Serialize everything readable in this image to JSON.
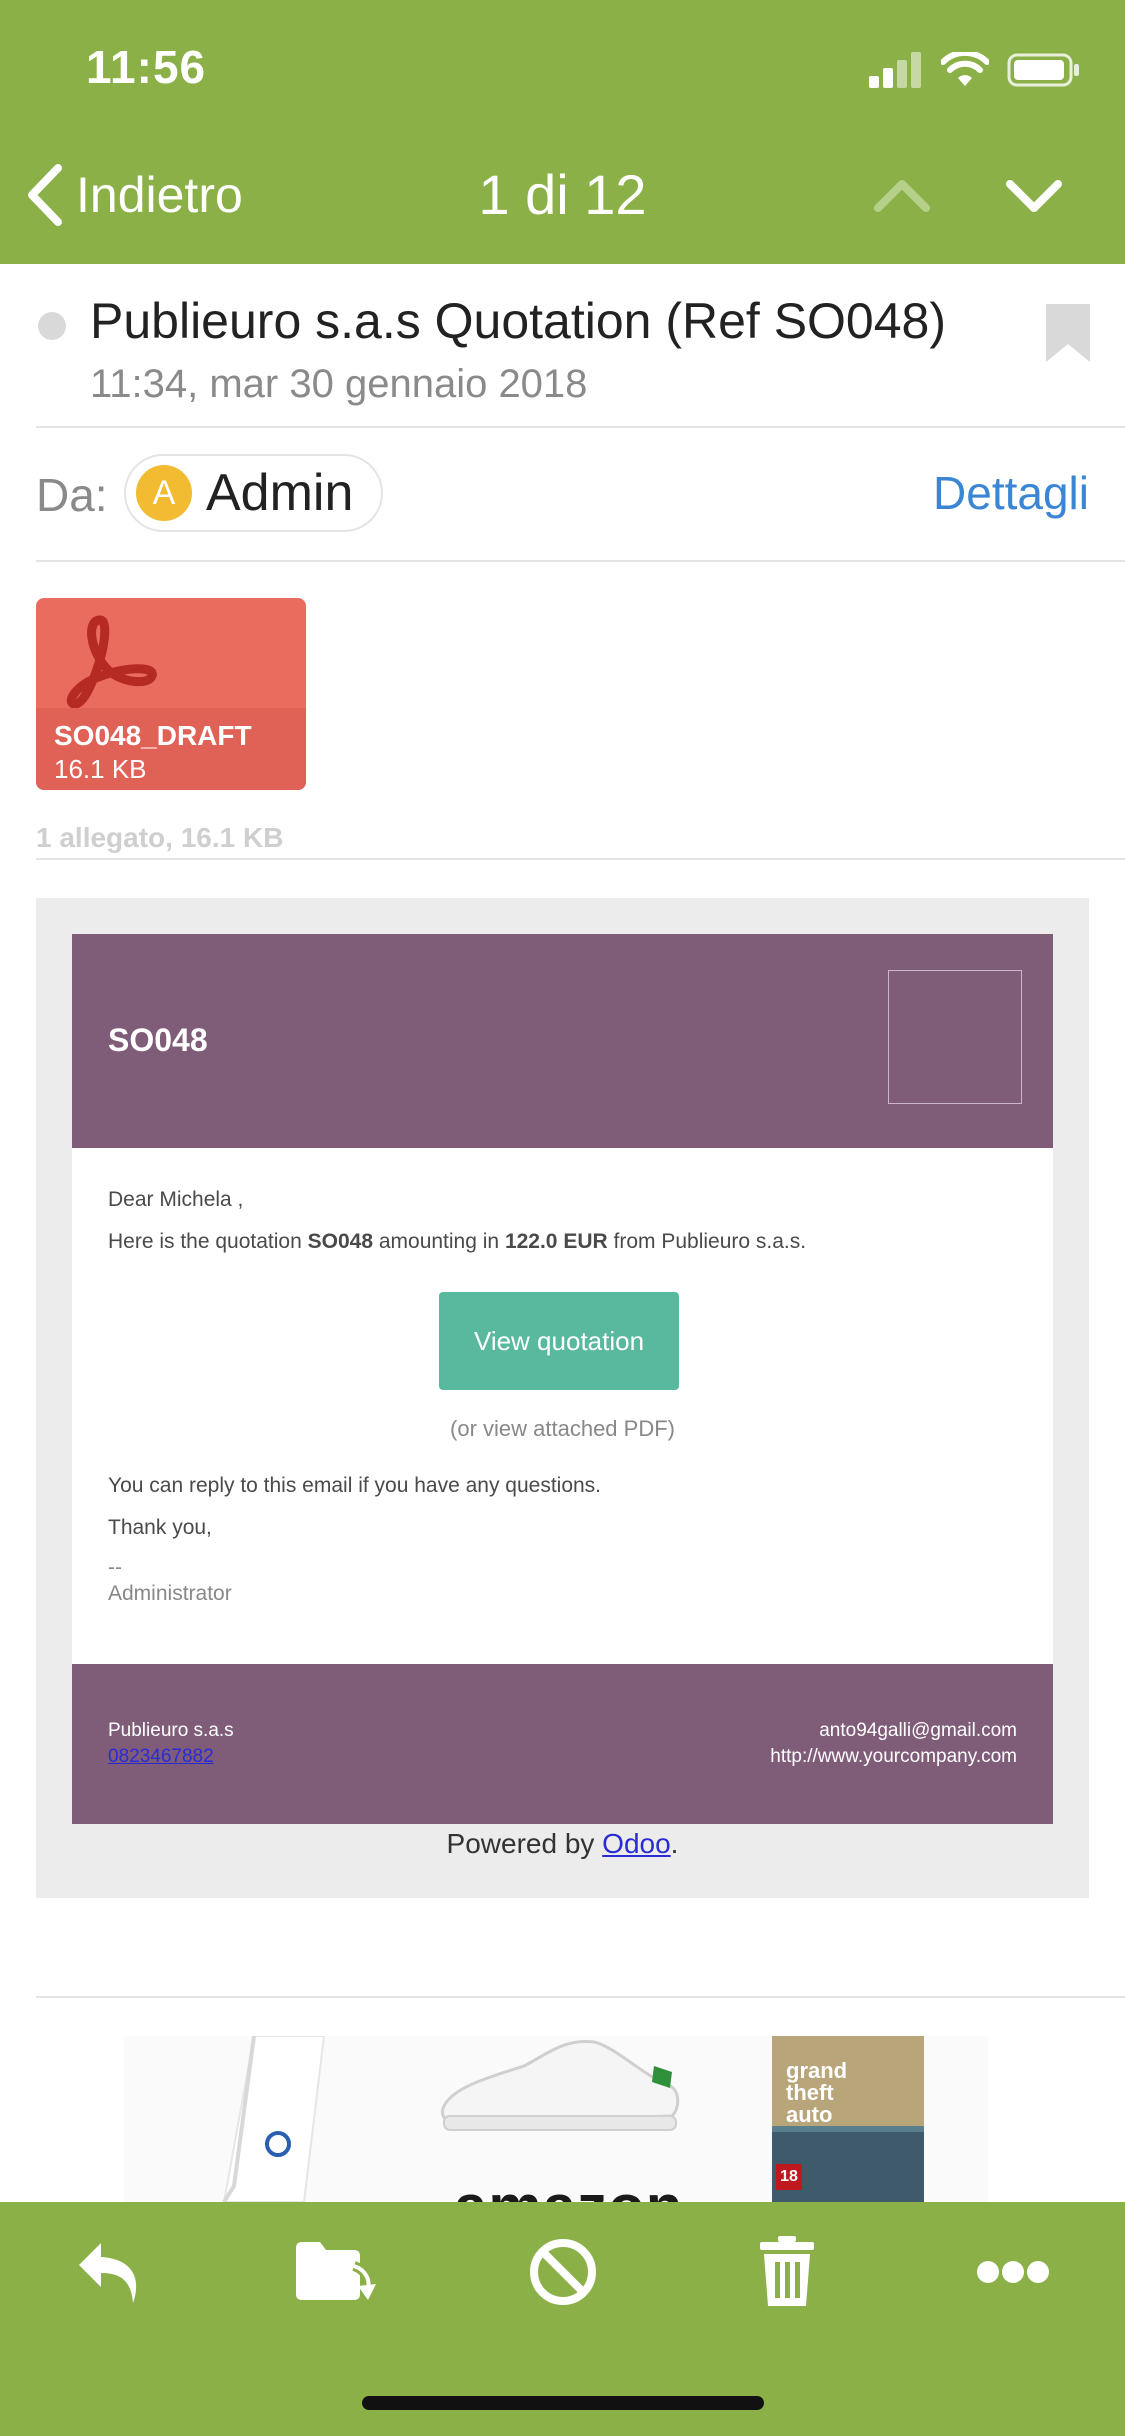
{
  "status_bar": {
    "time": "11:56"
  },
  "nav": {
    "back_label": "Indietro",
    "counter": "1 di 12"
  },
  "message": {
    "subject": "Publieuro s.a.s Quotation (Ref SO048)",
    "date": "11:34, mar 30 gennaio 2018",
    "from_label": "Da:",
    "sender_initial": "A",
    "sender_name": "Admin",
    "details_label": "Dettagli"
  },
  "attachment": {
    "name": "SO048_DRAFT",
    "size": "16.1 KB",
    "summary": "1 allegato, 16.1 KB"
  },
  "email": {
    "ref": "SO048",
    "greeting": "Dear Michela ,",
    "intro_prefix": "Here is the quotation ",
    "intro_ref": "SO048",
    "intro_middle": " amounting in ",
    "intro_amount": "122.0 EUR",
    "intro_suffix": " from Publieuro s.a.s.",
    "view_button": "View quotation",
    "or_pdf": "(or view attached PDF)",
    "reply_note": "You can reply to this email if you have any questions.",
    "thanks": "Thank you,",
    "signature_sep": "--",
    "signature": "Administrator",
    "footer_company": "Publieuro s.a.s",
    "footer_phone": "0823467882",
    "footer_email": "anto94galli@gmail.com",
    "footer_website": "http://www.yourcompany.com",
    "powered_prefix": "Powered by ",
    "powered_link": "Odoo",
    "powered_suffix": "."
  },
  "ad": {
    "wordmark": "amazon",
    "game_title_lines": [
      "grand",
      "theft",
      "auto"
    ],
    "game_rating": "18"
  },
  "colors": {
    "accent": "#8bb048",
    "email_header": "#7f5c78",
    "button": "#59b99e",
    "link": "#3a86d4",
    "attachment": "#ea6c5f"
  }
}
